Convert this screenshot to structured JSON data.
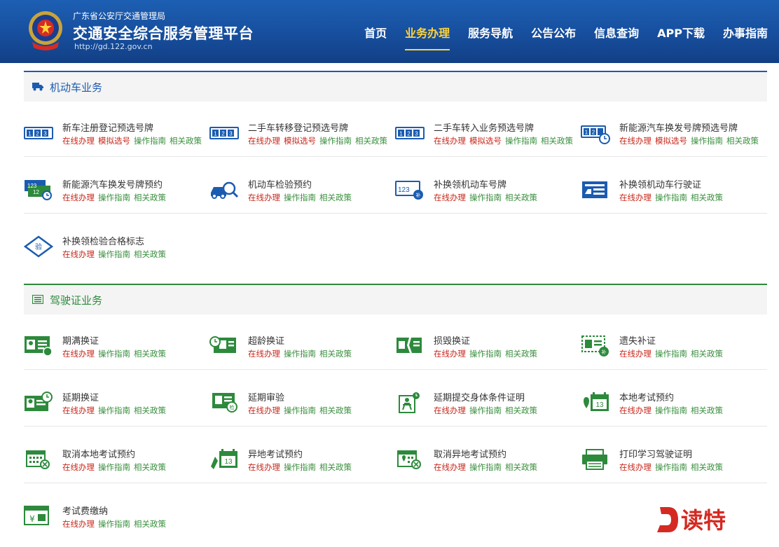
{
  "header": {
    "bureau": "广东省公安厅交通管理局",
    "title": "交通安全综合服务管理平台",
    "url": "http://gd.122.gov.cn",
    "nav": [
      "首页",
      "业务办理",
      "服务导航",
      "公告公布",
      "信息查询",
      "APP下载",
      "办事指南"
    ],
    "active_nav": "业务办理",
    "colors": {
      "header_bg": "#174e9d",
      "active_nav": "#ffd43b"
    }
  },
  "link_labels": {
    "online": "在线办理",
    "simulate": "模拟选号",
    "guide": "操作指南",
    "policy": "相关政策"
  },
  "sections": {
    "vehicle": {
      "title": "机动车业务",
      "icon": "truck-icon",
      "items": [
        {
          "name": "新车注册登记预选号牌",
          "icon": "plate-123-icon",
          "simulate": true
        },
        {
          "name": "二手车转移登记预选号牌",
          "icon": "plate-123-icon",
          "simulate": true
        },
        {
          "name": "二手车转入业务预选号牌",
          "icon": "plate-123-icon",
          "simulate": true
        },
        {
          "name": "新能源汽车换发号牌预选号牌",
          "icon": "plate-123-clock-icon",
          "simulate": true
        },
        {
          "name": "新能源汽车换发号牌预约",
          "icon": "green-plate-clock-icon",
          "simulate": false
        },
        {
          "name": "机动车检验预约",
          "icon": "car-inspect-icon",
          "simulate": false
        },
        {
          "name": "补换领机动车号牌",
          "icon": "plate-replace-icon",
          "simulate": false
        },
        {
          "name": "补换领机动车行驶证",
          "icon": "license-card-icon",
          "simulate": false
        },
        {
          "name": "补换领检验合格标志",
          "icon": "inspection-badge-icon",
          "simulate": false
        }
      ]
    },
    "license": {
      "title": "驾驶证业务",
      "icon": "card-list-icon",
      "items": [
        {
          "name": "期满换证",
          "icon": "id-card-icon"
        },
        {
          "name": "超龄换证",
          "icon": "id-card-age-icon"
        },
        {
          "name": "损毁换证",
          "icon": "damaged-card-icon"
        },
        {
          "name": "遗失补证",
          "icon": "lost-card-icon"
        },
        {
          "name": "延期换证",
          "icon": "card-clock-icon"
        },
        {
          "name": "延期审验",
          "icon": "card-review-icon"
        },
        {
          "name": "延期提交身体条件证明",
          "icon": "person-clock-icon"
        },
        {
          "name": "本地考试预约",
          "icon": "calendar-13-icon"
        },
        {
          "name": "取消本地考试预约",
          "icon": "calendar-cancel-icon"
        },
        {
          "name": "异地考试预约",
          "icon": "calendar-13-pin-icon"
        },
        {
          "name": "取消异地考试预约",
          "icon": "calendar-cancel-pin-icon"
        },
        {
          "name": "打印学习驾驶证明",
          "icon": "printer-icon"
        },
        {
          "name": "考试费缴纳",
          "icon": "yen-payment-icon"
        }
      ]
    }
  },
  "watermark": {
    "text": "读特",
    "logo_letter": "D",
    "color": "#d42a22"
  }
}
